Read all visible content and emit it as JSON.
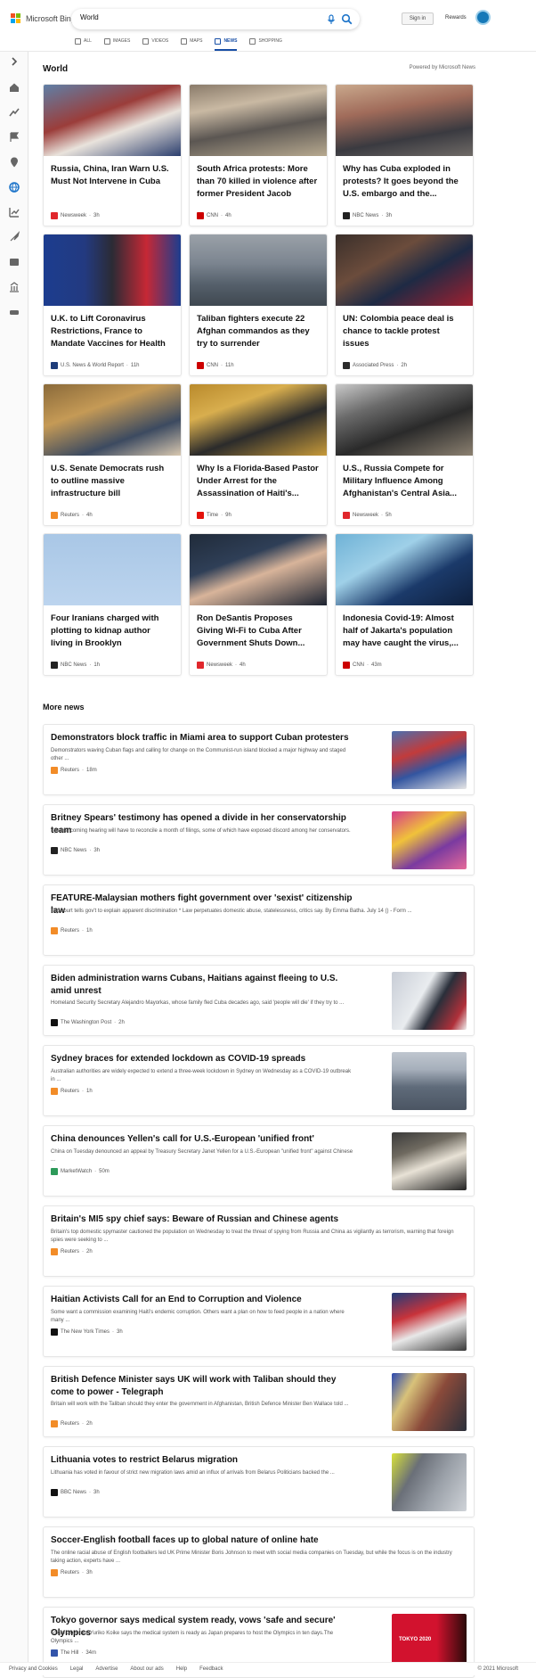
{
  "header": {
    "logo_text": "Microsoft Bing",
    "search_value": "World",
    "sign_in": "Sign in",
    "rewards": "Rewards"
  },
  "nav": [
    {
      "label": "ALL",
      "icon": "search-icon"
    },
    {
      "label": "IMAGES",
      "icon": "image-icon"
    },
    {
      "label": "VIDEOS",
      "icon": "video-icon"
    },
    {
      "label": "MAPS",
      "icon": "map-icon"
    },
    {
      "label": "NEWS",
      "icon": "news-icon",
      "active": true
    },
    {
      "label": "SHOPPING",
      "icon": "shopping-icon"
    }
  ],
  "world": {
    "title": "World",
    "powered_by": "Powered by Microsoft News"
  },
  "cards": [
    {
      "title": "Russia, China, Iran Warn U.S. Must Not Intervene in Cuba",
      "source": "Newsweek",
      "age": "3h",
      "logo_color": "#e0272c",
      "img": "linear-gradient(160deg,#5f7fa6 0%,#9b3d3a 40%,#e9e3dc 62%,#2c3f6e 100%)"
    },
    {
      "title": "South Africa protests: More than 70 killed in violence after former President Jacob Zuma...",
      "source": "CNN",
      "age": "4h",
      "logo_color": "#cc0000",
      "img": "linear-gradient(170deg,#8a7b6a 0%,#c9b9a3 30%,#5b5652 60%,#b7a98f 100%)"
    },
    {
      "title": "Why has Cuba exploded in protests? It goes beyond the U.S. embargo and the...",
      "source": "NBC News",
      "age": "3h",
      "logo_color": "#222222",
      "img": "linear-gradient(170deg,#c9a88c 0%,#a06b5a 35%,#3a3a40 70%,#6f6a66 100%)"
    },
    {
      "title": "U.K. to Lift Coronavirus Restrictions, France to Mandate Vaccines for Health Workers",
      "source": "U.S. News & World Report",
      "age": "11h",
      "logo_color": "#1f3d7a",
      "img": "linear-gradient(90deg,#1c3d8f 0%,#233a80 30%,#2b2b35 50%,#c62835 75%,#1c3d8f 100%)"
    },
    {
      "title": "Taliban fighters execute 22 Afghan commandos as they try to surrender",
      "source": "CNN",
      "age": "11h",
      "logo_color": "#cc0000",
      "img": "linear-gradient(180deg,#9aa1a8 0%,#7c8590 40%,#55606b 70%,#3f4850 100%)"
    },
    {
      "title": "UN: Colombia peace deal is chance to tackle protest issues",
      "source": "Associated Press",
      "age": "2h",
      "logo_color": "#2b2b2b",
      "img": "linear-gradient(150deg,#3a2f2a 0%,#6b4c3c 35%,#1e2a44 60%,#a02030 100%)"
    },
    {
      "title": "U.S. Senate Democrats rush to outline massive infrastructure bill",
      "source": "Reuters",
      "age": "4h",
      "logo_color": "#f28c28",
      "img": "linear-gradient(160deg,#8a6a3a 0%,#c59a56 35%,#3c4a60 70%,#d8c8b0 100%)"
    },
    {
      "title": "Why Is a Florida-Based Pastor Under Arrest for the Assassination of Haiti's...",
      "source": "Time",
      "age": "9h",
      "logo_color": "#e3120b",
      "img": "linear-gradient(160deg,#b98a2c 0%,#d8ae4e 30%,#2b2b2b 60%,#c79a3a 100%)"
    },
    {
      "title": "U.S., Russia Compete for Military Influence Among Afghanistan's Central Asia...",
      "source": "Newsweek",
      "age": "5h",
      "logo_color": "#e0272c",
      "img": "linear-gradient(160deg,#c9c9c9 0%,#6a6a6a 30%,#2a2a2a 60%,#8b8070 100%)"
    },
    {
      "title": "Four Iranians charged with plotting to kidnap author living in Brooklyn",
      "source": "NBC News",
      "age": "1h",
      "logo_color": "#222222",
      "img": "linear-gradient(180deg,#a9c7e6 0%,#bcd4ee 100%)"
    },
    {
      "title": "Ron DeSantis Proposes Giving Wi-Fi to Cuba After Government Shuts Down...",
      "source": "Newsweek",
      "age": "4h",
      "logo_color": "#e0272c",
      "img": "linear-gradient(160deg,#202b3a 0%,#2f3f57 35%,#d8b49a 55%,#1b2230 100%)"
    },
    {
      "title": "Indonesia Covid-19: Almost half of Jakarta's population may have caught the virus,...",
      "source": "CNN",
      "age": "43m",
      "logo_color": "#cc0000",
      "img": "linear-gradient(150deg,#6fb2d6 0%,#9fd0e8 35%,#1b3a6a 65%,#0e1f3c 100%)"
    }
  ],
  "more_news": {
    "title": "More news",
    "items": [
      {
        "title": "Demonstrators block traffic in Miami area to support Cuban protesters",
        "snippet": "Demonstrators waving Cuban flags and calling for change on the Communist-run island blocked a major highway and staged other ...",
        "source": "Reuters",
        "age": "18m",
        "logo_color": "#f28c28",
        "has_thumb": true,
        "thumb": "linear-gradient(160deg,#4a6fb0 0%,#c23b3b 35%,#3355a0 60%,#e6e6e6 100%)"
      },
      {
        "title": "Britney Spears' testimony has opened a divide in her conservatorship team",
        "snippet": "Spears' coming hearing will have to reconcile a month of filings, some of which have exposed discord among her conservators.",
        "source": "NBC News",
        "age": "3h",
        "logo_color": "#222222",
        "has_thumb": true,
        "thumb": "linear-gradient(150deg,#d63a8a 0%,#f0c23a 35%,#7a3aa0 65%,#e66a9a 100%)"
      },
      {
        "title": "FEATURE-Malaysian mothers fight government over 'sexist' citizenship law",
        "snippet": "Top court tells gov't to explain apparent discrimination * Law perpetuates domestic abuse, statelessness, critics say. By Emma Batha. July 14 () - Form ...",
        "source": "Reuters",
        "age": "1h",
        "logo_color": "#f28c28",
        "has_thumb": false
      },
      {
        "title": "Biden administration warns Cubans, Haitians against fleeing to U.S. amid unrest",
        "snippet": "Homeland Security Secretary Alejandro Mayorkas, whose family fled Cuba decades ago, said 'people will die' if they try to ...",
        "source": "The Washington Post",
        "age": "2h",
        "logo_color": "#111111",
        "has_thumb": true,
        "thumb": "linear-gradient(120deg,#c8cdd6 0%,#e9ecef 40%,#2a2f3a 60%,#b0303a 85%,#eeeeee 100%)"
      },
      {
        "title": "Sydney braces for extended lockdown as COVID-19 spreads",
        "snippet": "Australian authorities are widely expected to extend a three-week lockdown in Sydney on Wednesday as a COVID-19 outbreak in ...",
        "source": "Reuters",
        "age": "1h",
        "logo_color": "#f28c28",
        "has_thumb": true,
        "thumb": "linear-gradient(180deg,#bfc6cf 0%,#a6afbb 30%,#5f6b7a 60%,#4b5563 100%)"
      },
      {
        "title": "China denounces Yellen's call for U.S.-European 'unified front'",
        "snippet": "China on Tuesday denounced an appeal by Treasury Secretary Janet Yellen for a U.S.-European \"unified front\" against Chinese ...",
        "source": "MarketWatch",
        "age": "50m",
        "logo_color": "#2e9a5a",
        "has_thumb": true,
        "thumb": "linear-gradient(160deg,#3a3a3a 0%,#6f6a60 30%,#e8e2d6 55%,#222222 100%)"
      },
      {
        "title": "Britain's MI5 spy chief says: Beware of Russian and Chinese agents",
        "snippet": "Britain's top domestic spymaster cautioned the population on Wednesday to treat the threat of spying from Russia and China as vigilantly as terrorism, warning that foreign spies were seeking to ...",
        "source": "Reuters",
        "age": "2h",
        "logo_color": "#f28c28",
        "has_thumb": false
      },
      {
        "title": "Haitian Activists Call for an End to Corruption and Violence",
        "snippet": "Some want a commission examining Haiti's endemic corruption. Others want a plan on how to feed people in a nation where many ...",
        "source": "The New York Times",
        "age": "3h",
        "logo_color": "#111111",
        "has_thumb": true,
        "thumb": "linear-gradient(160deg,#1f3b7a 0%,#c8333a 35%,#e8e8e8 60%,#3a3a3a 100%)"
      },
      {
        "title": "British Defence Minister says UK will work with Taliban should they come to power - Telegraph",
        "snippet": "Britain will work with the Taliban should they enter the government in Afghanistan, British Defence Minister Ben Wallace told ...",
        "source": "Reuters",
        "age": "2h",
        "logo_color": "#f28c28",
        "has_thumb": true,
        "thumb": "linear-gradient(120deg,#2a48b0 0%,#d8c27a 25%,#8a4a3a 55%,#2a2f3a 100%)"
      },
      {
        "title": "Lithuania votes to restrict Belarus migration",
        "snippet": "Lithuania has voted in favour of strict new migration laws amid an influx of arrivals from Belarus Politicians backed the ...",
        "source": "BBC News",
        "age": "3h",
        "logo_color": "#111111",
        "has_thumb": true,
        "thumb": "linear-gradient(120deg,#d8e23a 0%,#6a6f78 30%,#9aa0a8 60%,#cfd3d8 100%)"
      },
      {
        "title": "Soccer-English football faces up to global nature of online hate",
        "snippet": "The online racial abuse of English footballers led UK Prime Minister Boris Johnson to meet with social media companies on Tuesday, but while the focus is on the industry taking action, experts have ...",
        "source": "Reuters",
        "age": "3h",
        "logo_color": "#f28c28",
        "has_thumb": false
      },
      {
        "title": "Tokyo governor says medical system ready, vows 'safe and secure' Olympics",
        "snippet": "Tokyo Governor Yuriko Koike says the medical system is ready as Japan prepares to host the Olympics in ten days.The Olympics ...",
        "source": "The Hill",
        "age": "34m",
        "logo_color": "#3355aa",
        "has_thumb": true,
        "thumb": "linear-gradient(90deg,#d2122e 0%,#d2122e 60%,#2a0a0a 100%)",
        "thumb_text": "TOKYO 2020"
      }
    ]
  },
  "footer": {
    "links": [
      "Privacy and Cookies",
      "Legal",
      "Advertise",
      "About our ads",
      "Help",
      "Feedback"
    ],
    "copyright": "© 2021 Microsoft"
  }
}
